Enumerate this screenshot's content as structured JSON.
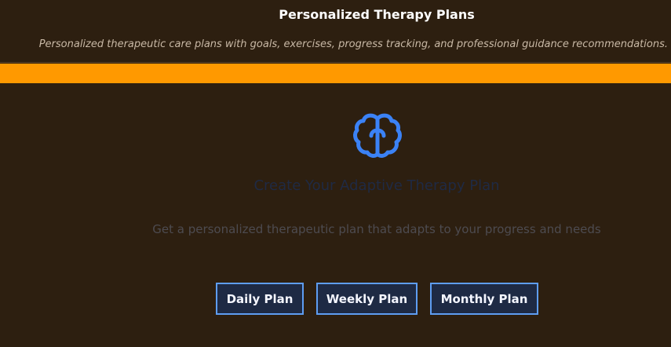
{
  "header": {
    "title": "Personalized Therapy Plans",
    "subtitle": "Personalized therapeutic care plans with goals, exercises, progress tracking, and professional guidance recommendations."
  },
  "main": {
    "icon": "brain-icon",
    "headline": "Create Your Adaptive Therapy Plan",
    "description": "Get a personalized therapeutic plan that adapts to your progress and needs"
  },
  "plans": {
    "daily_label": "Daily Plan",
    "weekly_label": "Weekly Plan",
    "monthly_label": "Monthly Plan"
  },
  "colors": {
    "background": "#2d1f10",
    "accent": "#ff9900",
    "icon": "#3b82f6",
    "button_bg": "#1e2a44",
    "button_border": "#5e9df2"
  }
}
